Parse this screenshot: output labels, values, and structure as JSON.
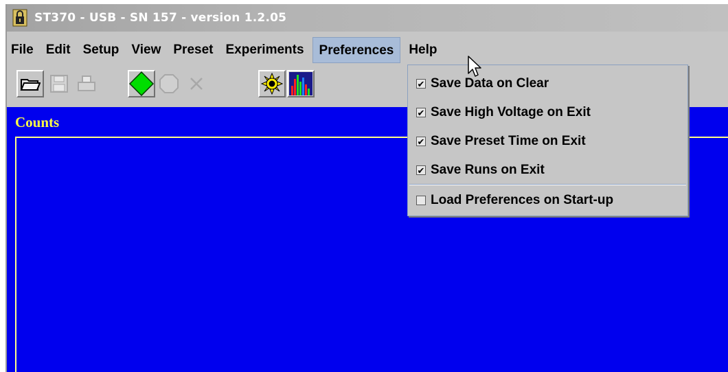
{
  "window": {
    "title": "ST370 - USB - SN 157 - version 1.2.05",
    "icon": "app-lock-icon"
  },
  "menubar": {
    "items": [
      {
        "label": "File"
      },
      {
        "label": "Edit"
      },
      {
        "label": "Setup"
      },
      {
        "label": "View"
      },
      {
        "label": "Preset"
      },
      {
        "label": "Experiments"
      },
      {
        "label": "Preferences",
        "active": true
      },
      {
        "label": "Help"
      }
    ]
  },
  "toolbar": {
    "buttons": [
      {
        "icon": "open-folder-icon",
        "enabled": true
      },
      {
        "icon": "save-disk-icon",
        "enabled": false
      },
      {
        "icon": "print-icon",
        "enabled": false
      },
      {
        "icon": "start-diamond-icon",
        "enabled": true
      },
      {
        "icon": "stop-octagon-icon",
        "enabled": false
      },
      {
        "icon": "clear-x-icon",
        "enabled": false
      },
      {
        "icon": "high-voltage-sun-icon",
        "enabled": true
      },
      {
        "icon": "histogram-bars-icon",
        "enabled": true
      }
    ]
  },
  "panel": {
    "label": "Counts",
    "background": "#0000ee",
    "label_color": "#ffff44"
  },
  "preferences_menu": {
    "items": [
      {
        "label": "Save Data on Clear",
        "checked": true
      },
      {
        "label": "Save High Voltage on Exit",
        "checked": true
      },
      {
        "label": "Save Preset Time on Exit",
        "checked": true
      },
      {
        "label": "Save Runs on Exit",
        "checked": true
      },
      {
        "label": "Load Preferences on Start-up",
        "checked": false
      }
    ],
    "check_mark": "✔"
  },
  "colors": {
    "window_bg": "#c6c6c6",
    "menu_highlight": "#a8bcd8",
    "start_green": "#00dd00",
    "sun_yellow": "#ffee00"
  }
}
